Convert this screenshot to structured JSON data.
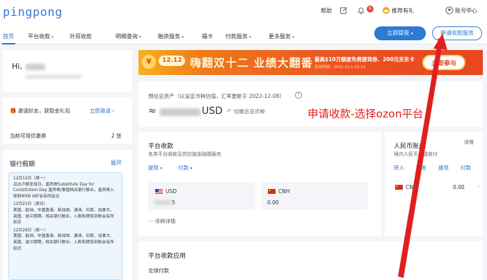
{
  "brand": {
    "logo_text": "pingpong"
  },
  "topbar": {
    "help_label": "帮助",
    "notification_count": "6",
    "refer_label": "推荐有礼",
    "account_label": "账号中心"
  },
  "nav": {
    "items": [
      {
        "label": "首页"
      },
      {
        "label": "平台收款"
      },
      {
        "label": "外贸收款"
      },
      {
        "label": "明细查询"
      },
      {
        "label": "融资服务"
      },
      {
        "label": "福卡"
      },
      {
        "label": "付款服务"
      },
      {
        "label": "更多服务"
      }
    ],
    "withdraw_button": "立即提现",
    "receive_button": "申请收款服务"
  },
  "user": {
    "greeting": "Hi,"
  },
  "invite": {
    "text": "邀请好友，获取金礼包",
    "link": "立即邀请",
    "coupon_label": "当前可用优惠券",
    "coupon_count": "2 张"
  },
  "holiday": {
    "title": "银行假期",
    "expand": "展开",
    "days": [
      {
        "date": "12月12日（周一）",
        "text": "瓜达卢佩圣母日，墨西哥Substitute Day for Constitution Day 墨西哥/泰国相关银行歇业，墨西哥入账和MXN VAT会有所延迟"
      },
      {
        "date": "12月25日（周日）",
        "text": "美国、欧洲、中国香港、新加坡、澳洲、印度、加拿大、英国、波兰假期，相关银行歇业，入账和提现到账会有所延迟"
      },
      {
        "date": "12月26日（周一）",
        "text": "美国、欧洲、中国香港、新加坡、澳洲、印度、加拿大、英国、波兰假期，相关银行歇业，入账和提现到账会有所延迟"
      }
    ]
  },
  "banner": {
    "coin": "¥",
    "date_tag": "12.12",
    "title": "嗨翻双十二 业绩大翻番",
    "promo": "最高$10万额度免费提现券、200元京东卡",
    "period": "活动时间：2022.12.1-12.12",
    "button": "立即参与"
  },
  "assets": {
    "label": "预估总资产（以设定币种估值，汇率更新于 2022-12-08）",
    "help": "?",
    "approx": "≈",
    "currency": "USD",
    "switch_icon": "⇄",
    "switch_label": "切换总览币种"
  },
  "platform": {
    "title": "平台收款",
    "desc": "各类平台收款及供应链金融赠服务",
    "withdraw": "提现",
    "pay": "付款",
    "accounts": [
      {
        "code": "USD",
        "amount": "5"
      },
      {
        "code": "CNH",
        "amount": "0.00"
      }
    ],
    "detail_link": "··· 币种详情"
  },
  "rmb": {
    "title": "人民币账户",
    "detail": "详情",
    "desc": "境内人民币便捷收付",
    "actions": [
      "转入",
      "转账",
      "提现",
      "付款"
    ],
    "code": "CNY",
    "amount": "0.00"
  },
  "apps": {
    "title": "平台收款应用",
    "global": "全球付款"
  },
  "annotation": {
    "text": "申请收款-选择ozon平台"
  },
  "colors": {
    "brand_blue": "#2b7ad4",
    "annotation_red": "#e01f1f",
    "banner_orange": "#ea5222"
  },
  "icons": [
    "edit-icon",
    "bell-icon",
    "gift-icon",
    "user-circle-icon",
    "chevron-down-icon",
    "switch-icon",
    "flag-usa-icon",
    "flag-china-icon"
  ]
}
